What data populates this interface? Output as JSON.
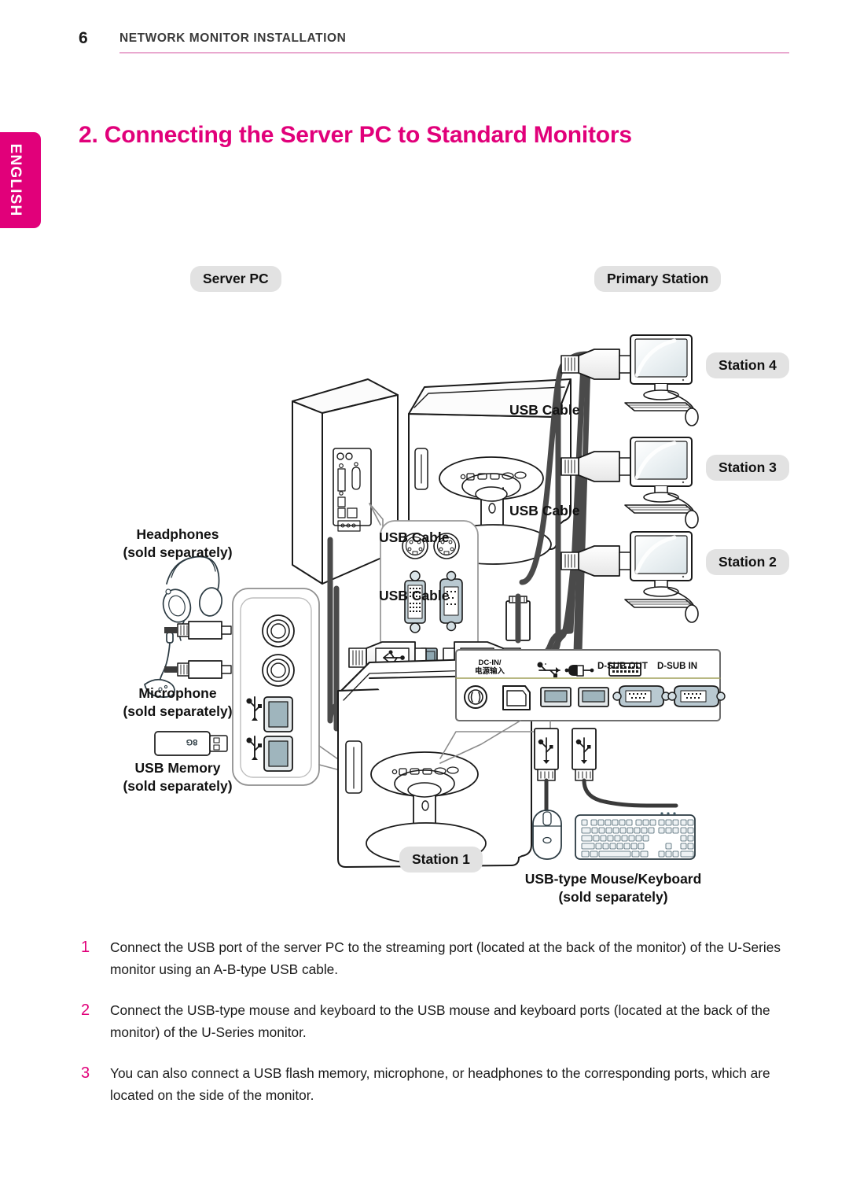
{
  "header": {
    "page_number": "6",
    "section_title": "NETWORK MONITOR INSTALLATION",
    "rule_color": "#e9a8cf"
  },
  "language_tab": {
    "label": "ENGLISH",
    "background": "#e1007a",
    "text_color": "#ffffff"
  },
  "chapter": {
    "title": "2. Connecting the Server PC to Standard Monitors",
    "color": "#e1007a"
  },
  "diagram": {
    "labels": {
      "server_pc": "Server PC",
      "primary_station": "Primary Station",
      "station_4": "Station 4",
      "station_3": "Station 3",
      "station_2": "Station 2",
      "station_1": "Station 1",
      "usb_cable_1": "USB Cable",
      "usb_cable_2": "USB Cable",
      "usb_cable_3": "USB Cable",
      "usb_cable_4": "USB Cable",
      "headphones_line1": "Headphones",
      "headphones_line2": "(sold separately)",
      "microphone_line1": "Microphone",
      "microphone_line2": "(sold separately)",
      "usb_memory_line1": "USB Memory",
      "usb_memory_line2": "(sold separately)",
      "mouse_keyboard_line1": "USB-type Mouse/Keyboard",
      "mouse_keyboard_line2": "(sold separately)",
      "usb_memory_capacity": "8G"
    },
    "port_panel": {
      "dc_in_line1": "DC-IN/",
      "dc_in_line2": "电源输入",
      "usb_icon": "usb-icon",
      "mouse_icon": "mouse-port-icon",
      "keyboard_icon": "keyboard-port-icon",
      "dsub_out": "D-SUB OUT",
      "dsub_in": "D-SUB IN"
    },
    "pill_background": "#e2e2e2"
  },
  "steps": [
    {
      "number": "1",
      "text": "Connect the USB port of the server PC to the streaming port (located at the back of the monitor) of the U-Series monitor using an A-B-type USB cable."
    },
    {
      "number": "2",
      "text": "Connect the USB-type mouse and keyboard to the USB mouse and keyboard ports (located at the back of the monitor) of the U-Series monitor."
    },
    {
      "number": "3",
      "text": "You can also connect a USB flash memory, microphone, or headphones to the corresponding ports, which are located on the side of the monitor."
    }
  ]
}
